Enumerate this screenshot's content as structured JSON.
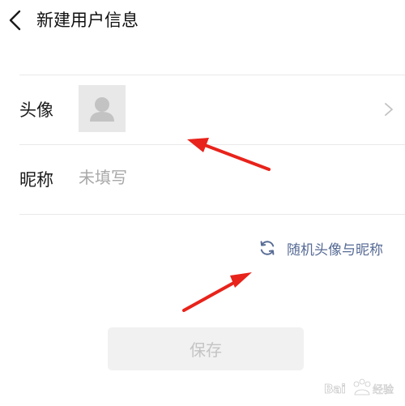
{
  "header": {
    "back_icon": "chevron-left-icon",
    "title": "新建用户信息"
  },
  "form": {
    "avatar_label": "头像",
    "avatar_icon": "user-silhouette-icon",
    "avatar_chevron_icon": "chevron-right-icon",
    "nickname_label": "昵称",
    "nickname_value": "",
    "nickname_placeholder": "未填写"
  },
  "random_link": {
    "icon": "refresh-icon",
    "label": "随机头像与昵称",
    "color": "#576b95"
  },
  "save_button": {
    "label": "保存",
    "state": "disabled"
  },
  "annotations": {
    "arrow_color": "#e8231b"
  },
  "watermark": {
    "text": "Bai 经验"
  }
}
